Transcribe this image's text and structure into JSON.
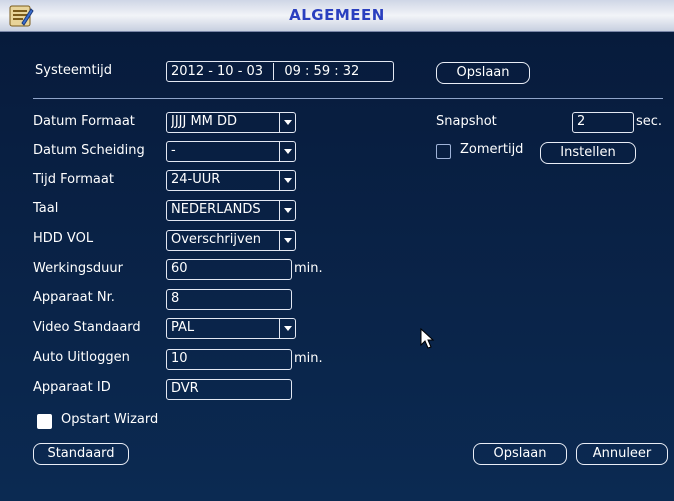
{
  "window": {
    "title": "ALGEMEEN"
  },
  "system_time": {
    "label": "Systeemtijd",
    "date": "2012  -  10  -  03",
    "time": "09 : 59 : 32",
    "save_button": "Opslaan"
  },
  "settings": {
    "date_format": {
      "label": "Datum Formaat",
      "value": "JJJJ MM DD"
    },
    "date_separator": {
      "label": "Datum Scheiding",
      "value": "-"
    },
    "time_format": {
      "label": "Tijd Formaat",
      "value": "24-UUR"
    },
    "language": {
      "label": "Taal",
      "value": "NEDERLANDS"
    },
    "hdd_full": {
      "label": "HDD VOL",
      "value": "Overschrijven"
    },
    "pack_duration": {
      "label": "Werkingsduur",
      "value": "60",
      "unit": "min."
    },
    "device_number": {
      "label": "Apparaat Nr.",
      "value": "8"
    },
    "video_standard": {
      "label": "Video Standaard",
      "value": "PAL"
    },
    "auto_logout": {
      "label": "Auto Uitloggen",
      "value": "10",
      "unit": "min."
    },
    "device_id": {
      "label": "Apparaat ID",
      "value": "DVR"
    },
    "startup_wizard": {
      "label": "Opstart Wizard",
      "checked": true
    }
  },
  "snapshot": {
    "label": "Snapshot",
    "value": "2",
    "unit": "sec."
  },
  "dst": {
    "label": "Zomertijd",
    "checked": false,
    "settings_button": "Instellen"
  },
  "footer": {
    "default_button": "Standaard",
    "save_button": "Opslaan",
    "cancel_button": "Annuleer"
  }
}
